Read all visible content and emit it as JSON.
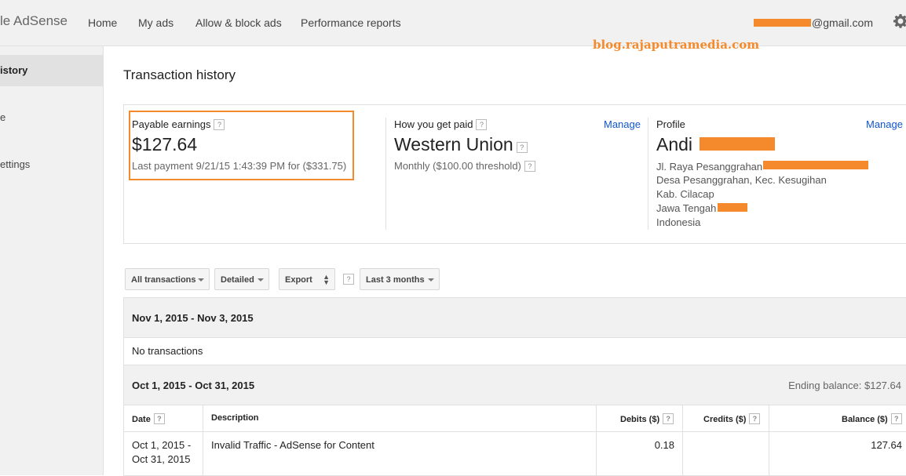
{
  "header": {
    "logo": "le AdSense",
    "nav": [
      "Home",
      "My ads",
      "Allow & block ads",
      "Performance reports"
    ],
    "email_suffix": "@gmail.com",
    "watermark": "blog.rajaputramedia.com"
  },
  "sidebar": {
    "items": [
      {
        "label": "istory",
        "active": true
      },
      {
        "label": "e",
        "active": false
      },
      {
        "label": "ettings",
        "active": false
      }
    ]
  },
  "page": {
    "title": "Transaction history"
  },
  "summary": {
    "earnings": {
      "label": "Payable earnings",
      "amount": "$127.64",
      "last_payment": "Last payment 9/21/15 1:43:39 PM for ($331.75)"
    },
    "payment": {
      "label": "How you get paid",
      "manage": "Manage",
      "method": "Western Union",
      "schedule": "Monthly ($100.00 threshold)"
    },
    "profile": {
      "label": "Profile",
      "manage": "Manage",
      "name": "Andi",
      "address": [
        "Jl. Raya Pesanggrahan",
        "Desa Pesanggrahan, Kec. Kesugihan",
        "Kab. Cilacap",
        "Jawa Tengah",
        "Indonesia"
      ]
    }
  },
  "filters": {
    "transactions": "All transactions",
    "detail": "Detailed",
    "export": "Export",
    "range": "Last 3 months"
  },
  "periods": [
    {
      "range": "Nov 1, 2015 - Nov 3, 2015",
      "note": "No transactions"
    },
    {
      "range": "Oct 1, 2015 - Oct 31, 2015",
      "ending": "Ending balance: $127.64",
      "columns": [
        "Date",
        "Description",
        "Debits ($)",
        "Credits ($)",
        "Balance ($)"
      ],
      "rows": [
        {
          "date_line1": "Oct 1, 2015 -",
          "date_line2": "Oct 31, 2015",
          "description": "Invalid Traffic - AdSense for Content",
          "debit": "0.18",
          "credit": "",
          "balance": "127.64"
        }
      ]
    }
  ],
  "ui": {
    "help": "?"
  },
  "colors": {
    "accent": "#f58a2c",
    "link": "#1155cc",
    "chrome": "#f1f1f1"
  }
}
